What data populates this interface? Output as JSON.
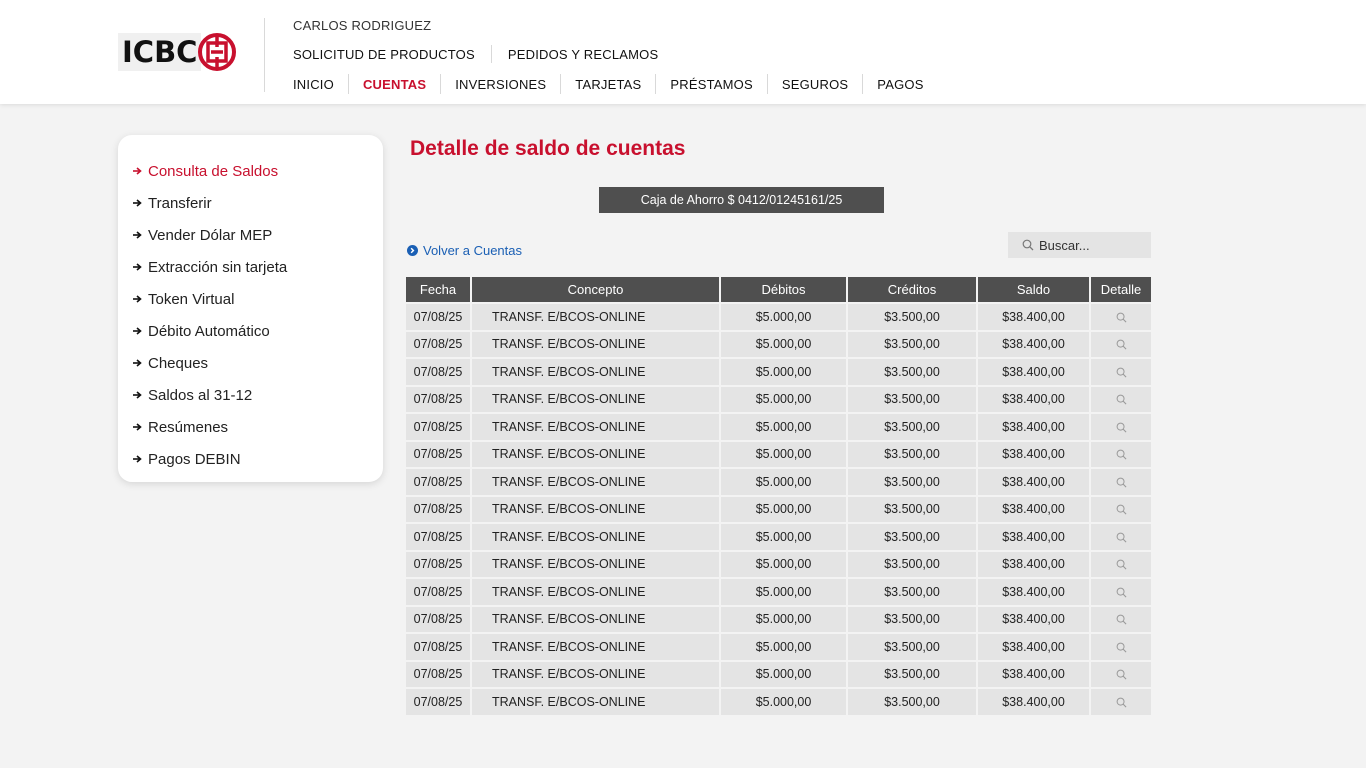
{
  "brand": {
    "logo_text": "ICBC",
    "accent_color": "#c8102e"
  },
  "header": {
    "user_name": "CARLOS RODRIGUEZ",
    "top_links": [
      "SOLICITUD DE PRODUCTOS",
      "PEDIDOS Y RECLAMOS"
    ],
    "nav": [
      {
        "label": "INICIO",
        "active": false
      },
      {
        "label": "CUENTAS",
        "active": true
      },
      {
        "label": "INVERSIONES",
        "active": false
      },
      {
        "label": "TARJETAS",
        "active": false
      },
      {
        "label": "PRÉSTAMOS",
        "active": false
      },
      {
        "label": "SEGUROS",
        "active": false
      },
      {
        "label": "PAGOS",
        "active": false
      }
    ]
  },
  "sidebar": {
    "items": [
      {
        "label": "Consulta de Saldos",
        "active": true
      },
      {
        "label": "Transferir",
        "active": false
      },
      {
        "label": "Vender Dólar MEP",
        "active": false
      },
      {
        "label": "Extracción sin tarjeta",
        "active": false
      },
      {
        "label": "Token Virtual",
        "active": false
      },
      {
        "label": "Débito Automático",
        "active": false
      },
      {
        "label": "Cheques",
        "active": false
      },
      {
        "label": "Saldos al 31-12",
        "active": false
      },
      {
        "label": "Resúmenes",
        "active": false
      },
      {
        "label": "Pagos DEBIN",
        "active": false
      }
    ]
  },
  "main": {
    "title": "Detalle de saldo de cuentas",
    "account_label": "Caja de Ahorro $ 0412/01245161/25",
    "back_link": "Volver a Cuentas",
    "search_placeholder": "Buscar...",
    "table": {
      "columns": [
        "Fecha",
        "Concepto",
        "Débitos",
        "Créditos",
        "Saldo",
        "Detalle"
      ],
      "rows": [
        [
          "07/08/25",
          "TRANSF. E/BCOS-ONLINE",
          "$5.000,00",
          "$3.500,00",
          "$38.400,00"
        ],
        [
          "07/08/25",
          "TRANSF. E/BCOS-ONLINE",
          "$5.000,00",
          "$3.500,00",
          "$38.400,00"
        ],
        [
          "07/08/25",
          "TRANSF. E/BCOS-ONLINE",
          "$5.000,00",
          "$3.500,00",
          "$38.400,00"
        ],
        [
          "07/08/25",
          "TRANSF. E/BCOS-ONLINE",
          "$5.000,00",
          "$3.500,00",
          "$38.400,00"
        ],
        [
          "07/08/25",
          "TRANSF. E/BCOS-ONLINE",
          "$5.000,00",
          "$3.500,00",
          "$38.400,00"
        ],
        [
          "07/08/25",
          "TRANSF. E/BCOS-ONLINE",
          "$5.000,00",
          "$3.500,00",
          "$38.400,00"
        ],
        [
          "07/08/25",
          "TRANSF. E/BCOS-ONLINE",
          "$5.000,00",
          "$3.500,00",
          "$38.400,00"
        ],
        [
          "07/08/25",
          "TRANSF. E/BCOS-ONLINE",
          "$5.000,00",
          "$3.500,00",
          "$38.400,00"
        ],
        [
          "07/08/25",
          "TRANSF. E/BCOS-ONLINE",
          "$5.000,00",
          "$3.500,00",
          "$38.400,00"
        ],
        [
          "07/08/25",
          "TRANSF. E/BCOS-ONLINE",
          "$5.000,00",
          "$3.500,00",
          "$38.400,00"
        ],
        [
          "07/08/25",
          "TRANSF. E/BCOS-ONLINE",
          "$5.000,00",
          "$3.500,00",
          "$38.400,00"
        ],
        [
          "07/08/25",
          "TRANSF. E/BCOS-ONLINE",
          "$5.000,00",
          "$3.500,00",
          "$38.400,00"
        ],
        [
          "07/08/25",
          "TRANSF. E/BCOS-ONLINE",
          "$5.000,00",
          "$3.500,00",
          "$38.400,00"
        ],
        [
          "07/08/25",
          "TRANSF. E/BCOS-ONLINE",
          "$5.000,00",
          "$3.500,00",
          "$38.400,00"
        ],
        [
          "07/08/25",
          "TRANSF. E/BCOS-ONLINE",
          "$5.000,00",
          "$3.500,00",
          "$38.400,00"
        ]
      ]
    }
  }
}
